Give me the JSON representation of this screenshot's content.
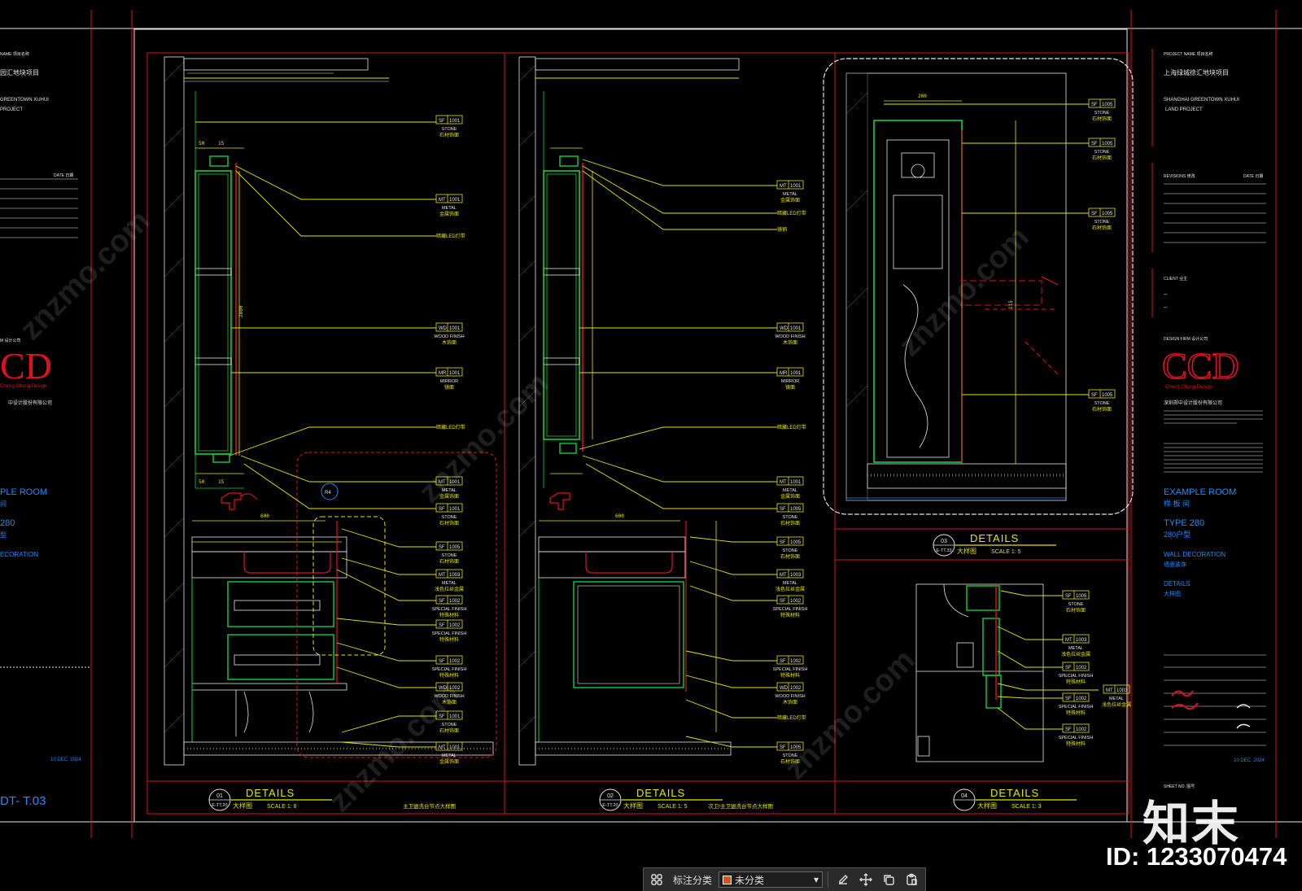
{
  "colors": {
    "red": "#e01020",
    "yellow": "#e8e400",
    "green": "#10d040",
    "white": "#e6e6e6",
    "cyan": "#1e8cff",
    "bg": "#000000"
  },
  "sheet_left": {
    "project_line1": "园汇地块项目",
    "project_line2": "GREENTOWN XUHUI",
    "project_line3": "PROJECT",
    "date_label": "DATE 日期",
    "room": "PLE ROOM",
    "type": "280",
    "type_cn": "型",
    "decoration": "ECORATION",
    "sheet_no": "DT- T.03",
    "issue_date": "10 DEC. 2024"
  },
  "sheet_right": {
    "project_name_label": "PROJECT NAME 项目名称",
    "project_cn": "上海绿城徐汇地块项目",
    "project_en1": "SHANGHAI GREENTOWN XUHUI",
    "project_en2": "LAND PROJECT",
    "revisions_label": "REVISIONS 修改",
    "date_label": "DATE 日期",
    "client_label": "CLIENT 业主",
    "client_dash1": "--",
    "client_dash2": "--",
    "design_firm_label": "DESIGN FIRM 设计公司",
    "logo": "CCD",
    "logo_sub": "Cheng Chung Design",
    "firm_cn": "深圳郑中设计股份有限公司",
    "room": "EXAMPLE ROOM",
    "room_cn": "样 板 间",
    "type": "TYPE 280",
    "type_cn": "280户型",
    "decoration": "WALL DECORATION",
    "decoration_cn": "墙面装饰",
    "details": "DETAILS",
    "details_cn": "大样图",
    "sheet_no_label": "SHEET NO. 图号",
    "issue_date": "10 DEC. 2024"
  },
  "panels": [
    {
      "id": "01",
      "ref": "E-TT.20",
      "title": "DETAILS",
      "title_cn": "大样图",
      "scale": "SCALE 1: 8",
      "note": "主卫盥洗台节点大样图"
    },
    {
      "id": "02",
      "ref": "E-TT.20",
      "title": "DETAILS",
      "title_cn": "大样图",
      "scale": "SCALE 1: 5",
      "note": "次卫/主卫盥洗台节点大样图"
    },
    {
      "id": "03",
      "ref": "E-TT.33",
      "title": "DETAILS",
      "title_cn": "大样图",
      "scale": "SCALE 1: 5",
      "note": ""
    },
    {
      "id": "04",
      "ref": "",
      "title": "DETAILS",
      "title_cn": "大样图",
      "scale": "SCALE 1: 3",
      "note": ""
    }
  ],
  "tags_p1": [
    {
      "code": "SF",
      "num": "1001",
      "name": "STONE",
      "cn": "石材饰面"
    },
    {
      "code": "MT",
      "num": "1001",
      "name": "METAL",
      "cn": "金属饰面"
    },
    {
      "code": "",
      "num": "",
      "name": "",
      "cn": "暗藏LED灯带"
    },
    {
      "code": "WD",
      "num": "1001",
      "name": "WOOD FINISH",
      "cn": "木饰面"
    },
    {
      "code": "MR",
      "num": "1001",
      "name": "MIRROR",
      "cn": "镜面"
    },
    {
      "code": "",
      "num": "",
      "name": "",
      "cn": "暗藏LED灯带"
    },
    {
      "code": "MT",
      "num": "1001",
      "name": "METAL",
      "cn": "金属饰面"
    },
    {
      "code": "SF",
      "num": "1001",
      "name": "STONE",
      "cn": "石材饰面"
    },
    {
      "code": "SF",
      "num": "1005",
      "name": "STONE",
      "cn": "石材饰面"
    },
    {
      "code": "MT",
      "num": "1003",
      "name": "METAL",
      "cn": "浅色拉丝金属"
    },
    {
      "code": "SF",
      "num": "1002",
      "name": "SPECIAL FINISH",
      "cn": "特殊材料"
    },
    {
      "code": "SF",
      "num": "1002",
      "name": "SPECIAL FINISH",
      "cn": "特殊材料"
    },
    {
      "code": "SF",
      "num": "1002",
      "name": "SPECIAL FINISH",
      "cn": "特殊材料"
    },
    {
      "code": "WD",
      "num": "1002",
      "name": "WOOD FINISH",
      "cn": "木饰面"
    },
    {
      "code": "SF",
      "num": "1001",
      "name": "STONE",
      "cn": "石材饰面"
    },
    {
      "code": "MT",
      "num": "1001",
      "name": "METAL",
      "cn": "金属饰面"
    }
  ],
  "tags_p2": [
    {
      "code": "MT",
      "num": "1001",
      "name": "METAL",
      "cn": "金属饰面"
    },
    {
      "code": "",
      "num": "",
      "name": "",
      "cn": "暗藏LED灯带"
    },
    {
      "code": "",
      "num": "",
      "name": "",
      "cn": "镜钢"
    },
    {
      "code": "WD",
      "num": "1001",
      "name": "WOOD FINISH",
      "cn": "木饰面"
    },
    {
      "code": "MR",
      "num": "1001",
      "name": "MIRROR",
      "cn": "镜面"
    },
    {
      "code": "",
      "num": "",
      "name": "",
      "cn": "暗藏LED灯带"
    },
    {
      "code": "MT",
      "num": "1001",
      "name": "METAL",
      "cn": "金属饰面"
    },
    {
      "code": "SF",
      "num": "1005",
      "name": "STONE",
      "cn": "石材饰面"
    },
    {
      "code": "SF",
      "num": "1005",
      "name": "STONE",
      "cn": "石材饰面"
    },
    {
      "code": "MT",
      "num": "1003",
      "name": "METAL",
      "cn": "浅色拉丝金属"
    },
    {
      "code": "SF",
      "num": "1002",
      "name": "SPECIAL FINISH",
      "cn": "特殊材料"
    },
    {
      "code": "SF",
      "num": "1002",
      "name": "SPECIAL FINISH",
      "cn": "特殊材料"
    },
    {
      "code": "WD",
      "num": "1002",
      "name": "WOOD FINISH",
      "cn": "木饰面"
    },
    {
      "code": "",
      "num": "",
      "name": "",
      "cn": "暗藏LED灯带"
    },
    {
      "code": "SF",
      "num": "1005",
      "name": "STONE",
      "cn": "石材饰面"
    }
  ],
  "tags_p3": [
    {
      "code": "SF",
      "num": "1005",
      "name": "STONE",
      "cn": "石材饰面"
    },
    {
      "code": "SF",
      "num": "1005",
      "name": "STONE",
      "cn": "石材饰面"
    },
    {
      "code": "SF",
      "num": "1005",
      "name": "STONE",
      "cn": "石材饰面"
    },
    {
      "code": "SF",
      "num": "1005",
      "name": "STONE",
      "cn": "石材饰面"
    }
  ],
  "tags_p4": [
    {
      "code": "SF",
      "num": "1005",
      "name": "STONE",
      "cn": "石材饰面"
    },
    {
      "code": "MT",
      "num": "1003",
      "name": "METAL",
      "cn": "浅色拉丝金属"
    },
    {
      "code": "SF",
      "num": "1002",
      "name": "SPECIAL FINISH",
      "cn": "特殊材料"
    },
    {
      "code": "MT",
      "num": "1003",
      "name": "METAL",
      "cn": "浅色拉丝金属"
    },
    {
      "code": "SF",
      "num": "1002",
      "name": "SPECIAL FINISH",
      "cn": "特殊材料"
    },
    {
      "code": "SF",
      "num": "1002",
      "name": "SPECIAL FINISH",
      "cn": "特殊材料"
    }
  ],
  "dims": {
    "d600": "600",
    "d50": "50",
    "d15": "15",
    "d2800": "2800",
    "d115": "115"
  },
  "toolbar": {
    "label": "标注分类",
    "selected": "未分类",
    "swatch": "#e0501a"
  },
  "watermark": {
    "logo": "知末",
    "id": "ID: 1233070474",
    "diagonal": "znzmo.com"
  }
}
